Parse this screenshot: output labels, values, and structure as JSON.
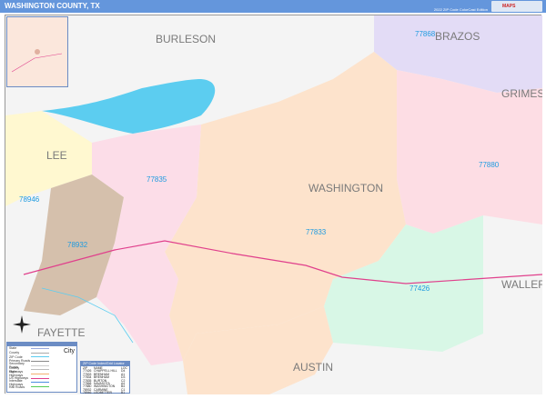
{
  "header": {
    "title": "WASHINGTON COUNTY, TX",
    "edition": "2022 ZIP Code ColorCast Edition",
    "logo_text": "MAPS"
  },
  "counties": {
    "burleson": "BURLESON",
    "brazos": "BRAZOS",
    "grimes": "GRIMES",
    "lee": "LEE",
    "washington": "WASHINGTON",
    "fayette": "FAYETTE",
    "austin": "AUSTIN",
    "waller": "WALLER"
  },
  "zips": {
    "z77868": "77868",
    "z77835": "77835",
    "z77880": "77880",
    "z78946": "78946",
    "z78932": "78932",
    "z77833": "77833",
    "z77426": "77426"
  },
  "colors": {
    "lake": "#5ccdf0",
    "zip77835": "#fcdde8",
    "zip77833": "#fde3cc",
    "zip77880": "#fddde4",
    "zip77868": "#e3dcf6",
    "zip77426": "#d8f7e6",
    "zip78932": "#d5c0ac",
    "zip78946": "#fff8d0",
    "highway": "#e0408c"
  },
  "legend": {
    "title": "Legend",
    "city_label": "City",
    "rows": [
      "State",
      "County",
      "ZIP Code",
      "Primary Roads",
      "Secondary Roads",
      "County Highways",
      "State Highways",
      "US Highways",
      "Interstate Highways",
      "Rail Roads"
    ]
  },
  "zip_table": {
    "title": "ZIP Code Index/Grid Locator",
    "headers": [
      "ZIP",
      "NAME",
      "LOC"
    ],
    "rows": [
      [
        "77426",
        "CHAPPELL HILL",
        "D4"
      ],
      [
        "77833",
        "BRENHAM",
        "A1"
      ],
      [
        "77834",
        "BRENHAM",
        "D3"
      ],
      [
        "77835",
        "BURTON",
        "C2"
      ],
      [
        "77868",
        "NAVASOTA",
        "A4"
      ],
      [
        "77880",
        "WASHINGTON",
        "B4"
      ],
      [
        "78932",
        "CARMINE",
        "C1"
      ],
      [
        "78946",
        "LEDBETTER",
        "B1"
      ]
    ]
  }
}
